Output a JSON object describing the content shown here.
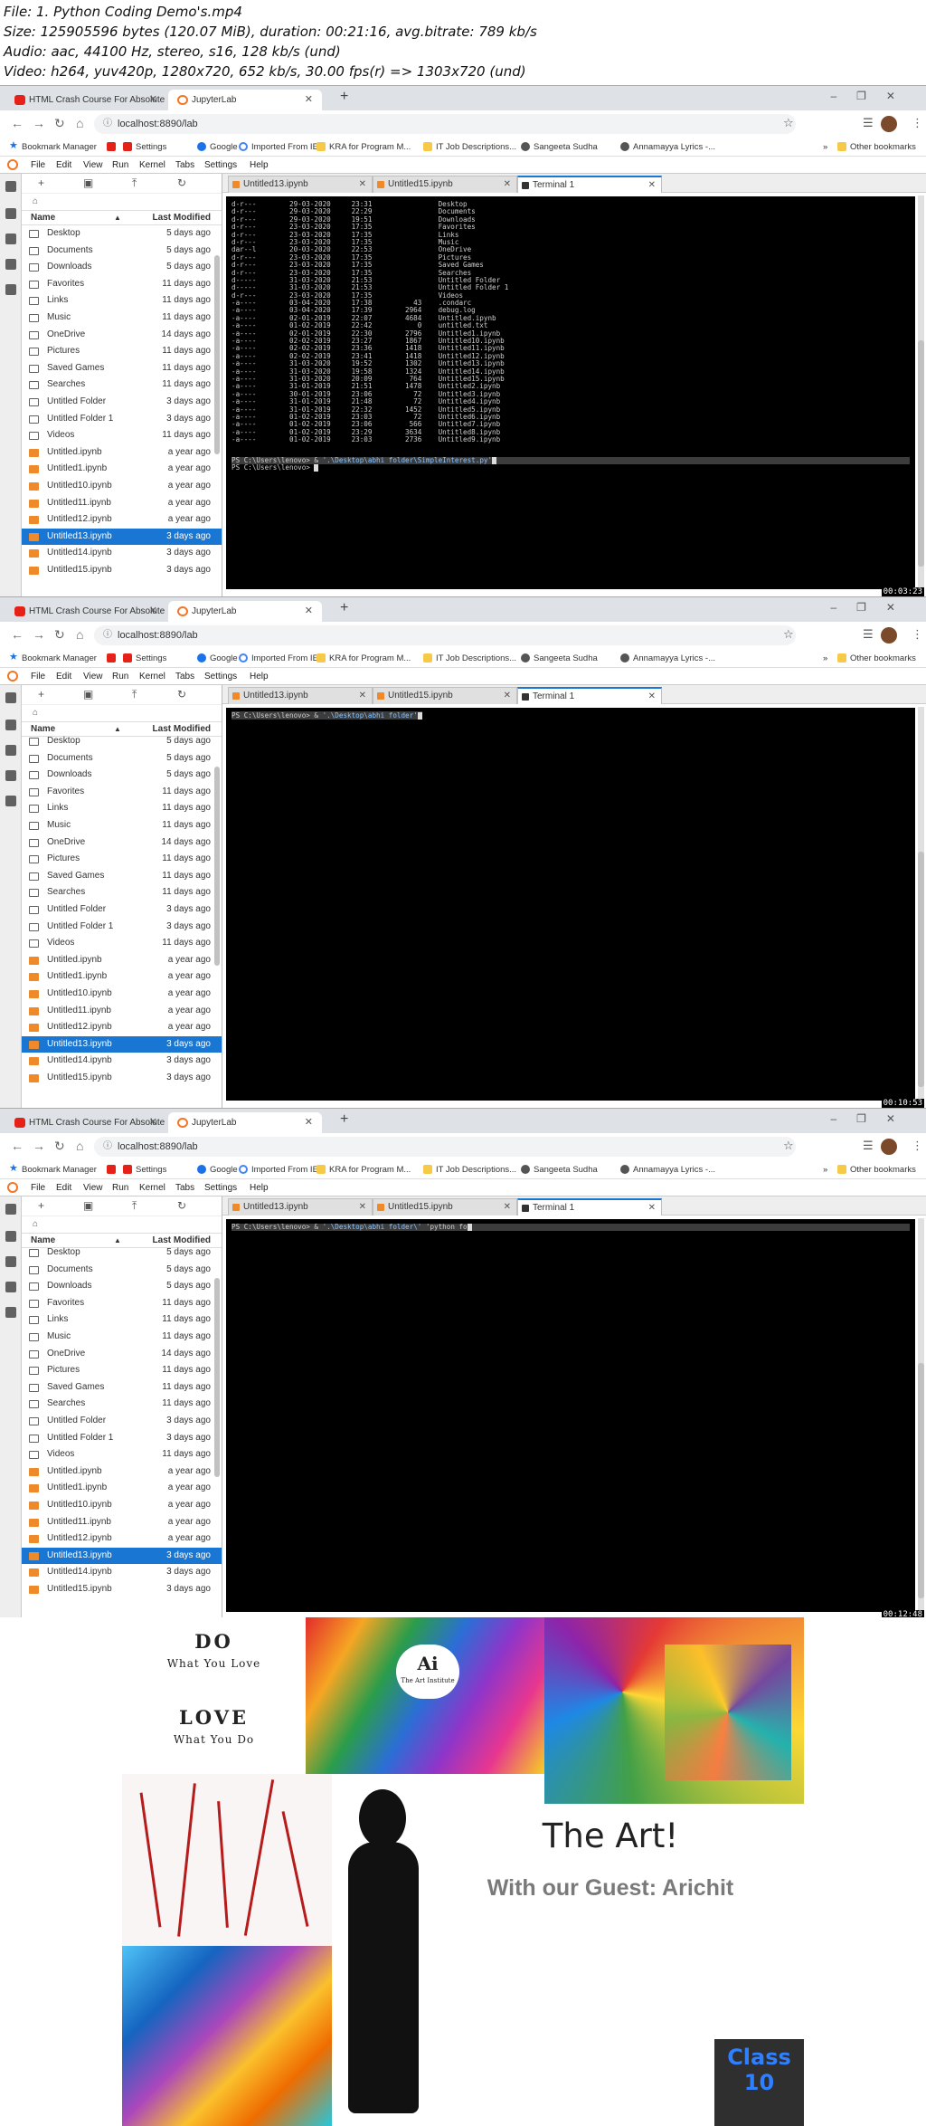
{
  "info": {
    "line1": "File: 1. Python Coding Demo's.mp4",
    "line2": "Size: 125905596 bytes (120.07 MiB), duration: 00:21:16, avg.bitrate: 789 kb/s",
    "line3": "Audio: aac, 44100 Hz, stereo, s16, 128 kb/s (und)",
    "line4": "Video: h264, yuv420p, 1280x720, 652 kb/s, 30.00 fps(r) => 1303x720 (und)"
  },
  "browser": {
    "tabs": [
      "HTML Crash Course For Absolute",
      "JupyterLab"
    ],
    "url": "localhost:8890/lab",
    "bookmarks": [
      "Bookmark Manager",
      "Settings",
      "Google",
      "Imported From IE",
      "KRA for Program M...",
      "IT Job Descriptions...",
      "Sangeeta Sudha",
      "Annamayya Lyrics -...",
      "Other bookmarks"
    ]
  },
  "jupyter": {
    "menu": [
      "File",
      "Edit",
      "View",
      "Run",
      "Kernel",
      "Tabs",
      "Settings",
      "Help"
    ],
    "fb_name": "Name",
    "fb_modified": "Last Modified",
    "doc_tabs": [
      "Untitled13.ipynb",
      "Untitled15.ipynb",
      "Terminal 1"
    ],
    "files": [
      {
        "name": "Desktop",
        "mod": "5 days ago",
        "type": "folder"
      },
      {
        "name": "Documents",
        "mod": "5 days ago",
        "type": "folder"
      },
      {
        "name": "Downloads",
        "mod": "5 days ago",
        "type": "folder"
      },
      {
        "name": "Favorites",
        "mod": "11 days ago",
        "type": "folder"
      },
      {
        "name": "Links",
        "mod": "11 days ago",
        "type": "folder"
      },
      {
        "name": "Music",
        "mod": "11 days ago",
        "type": "folder"
      },
      {
        "name": "OneDrive",
        "mod": "14 days ago",
        "type": "folder"
      },
      {
        "name": "Pictures",
        "mod": "11 days ago",
        "type": "folder"
      },
      {
        "name": "Saved Games",
        "mod": "11 days ago",
        "type": "folder"
      },
      {
        "name": "Searches",
        "mod": "11 days ago",
        "type": "folder"
      },
      {
        "name": "Untitled Folder",
        "mod": "3 days ago",
        "type": "folder"
      },
      {
        "name": "Untitled Folder 1",
        "mod": "3 days ago",
        "type": "folder"
      },
      {
        "name": "Videos",
        "mod": "11 days ago",
        "type": "folder"
      },
      {
        "name": "Untitled.ipynb",
        "mod": "a year ago",
        "type": "nb"
      },
      {
        "name": "Untitled1.ipynb",
        "mod": "a year ago",
        "type": "nb"
      },
      {
        "name": "Untitled10.ipynb",
        "mod": "a year ago",
        "type": "nb"
      },
      {
        "name": "Untitled11.ipynb",
        "mod": "a year ago",
        "type": "nb"
      },
      {
        "name": "Untitled12.ipynb",
        "mod": "a year ago",
        "type": "nb"
      },
      {
        "name": "Untitled13.ipynb",
        "mod": "3 days ago",
        "type": "nb"
      },
      {
        "name": "Untitled14.ipynb",
        "mod": "3 days ago",
        "type": "nb"
      },
      {
        "name": "Untitled15.ipynb",
        "mod": "3 days ago",
        "type": "nb"
      }
    ],
    "selected": "Untitled13.ipynb"
  },
  "frames": [
    {
      "timestamp": "00:03:23",
      "listing": [
        "d-r---        29-03-2020     23:31                Desktop",
        "d-r---        29-03-2020     22:29                Documents",
        "d-r---        29-03-2020     19:51                Downloads",
        "d-r---        23-03-2020     17:35                Favorites",
        "d-r---        23-03-2020     17:35                Links",
        "d-r---        23-03-2020     17:35                Music",
        "dar--l        20-03-2020     22:53                OneDrive",
        "d-r---        23-03-2020     17:35                Pictures",
        "d-r---        23-03-2020     17:35                Saved Games",
        "d-r---        23-03-2020     17:35                Searches",
        "d-----        31-03-2020     21:53                Untitled Folder",
        "d-----        31-03-2020     21:53                Untitled Folder 1",
        "d-r---        23-03-2020     17:35                Videos",
        "-a----        03-04-2020     17:38          43    .condarc",
        "-a----        03-04-2020     17:39        2964    debug.log",
        "-a----        02-01-2019     22:07        4684    Untitled.ipynb",
        "-a----        01-02-2019     22:42           0    untitled.txt",
        "-a----        02-01-2019     22:30        2796    Untitled1.ipynb",
        "-a----        02-02-2019     23:27        1867    Untitled10.ipynb",
        "-a----        02-02-2019     23:36        1418    Untitled11.ipynb",
        "-a----        02-02-2019     23:41        1418    Untitled12.ipynb",
        "-a----        31-03-2020     19:52        1302    Untitled13.ipynb",
        "-a----        31-03-2020     19:58        1324    Untitled14.ipynb",
        "-a----        31-03-2020     20:09         764    Untitled15.ipynb",
        "-a----        31-01-2019     21:51        1478    Untitled2.ipynb",
        "-a----        30-01-2019     23:06          72    Untitled3.ipynb",
        "-a----        31-01-2019     21:48          72    Untitled4.ipynb",
        "-a----        31-01-2019     22:32        1452    Untitled5.ipynb",
        "-a----        01-02-2019     23:03          72    Untitled6.ipynb",
        "-a----        01-02-2019     23:06         566    Untitled7.ipynb",
        "-a----        01-02-2019     23:29        3634    Untitled8.ipynb",
        "-a----        01-02-2019     23:03        2736    Untitled9.ipynb"
      ],
      "prompt1": "PS C:\\Users\\lenovo> & ",
      "cmd1": "'.\\Desktop\\abhi folder\\SimpleInterest.py'",
      "prompt2": "PS C:\\Users\\lenovo> "
    },
    {
      "timestamp": "00:10:53",
      "prompt1": "PS C:\\Users\\lenovo> & ",
      "cmd1": "'.\\Desktop\\abhi folder'"
    },
    {
      "timestamp": "00:12:48",
      "prompt1": "PS C:\\Users\\lenovo> & ",
      "cmd1": "'.\\Desktop\\abhi folder\\'",
      "cmd2": " 'python fo"
    }
  ],
  "art": {
    "do": "DO",
    "do_sub": "What You Love",
    "love": "LOVE",
    "love_sub": "What You Do",
    "logo_a": "Ai",
    "logo_sub": "The Art Institute",
    "title": "The Art!",
    "subtitle": "With our Guest: Arichit",
    "class1": "Class",
    "class2": "10"
  }
}
